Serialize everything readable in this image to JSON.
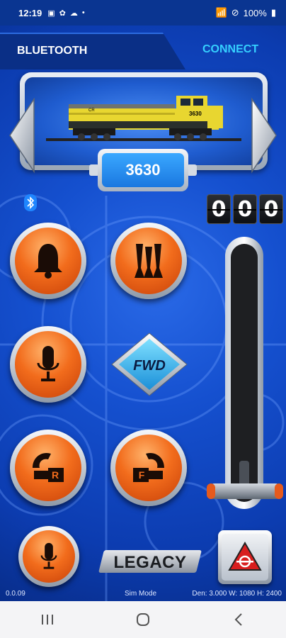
{
  "statusbar": {
    "time": "12:19",
    "battery": "100%"
  },
  "header": {
    "bluetooth_label": "BLUETOOTH",
    "connect_label": "CONNECT"
  },
  "engine": {
    "road_number": "3630",
    "cab_number": "3630",
    "brand_mark": "CR"
  },
  "counter": {
    "digits": [
      "0",
      "0",
      "0"
    ]
  },
  "controls": {
    "bell": "bell-icon",
    "horn": "horn-icon",
    "record": "microphone-icon",
    "direction_label": "FWD",
    "rear_coupler_label": "R",
    "front_coupler_label": "F",
    "voice": "microphone-icon"
  },
  "brand": {
    "legacy_label": "LEGACY"
  },
  "footer": {
    "version": "0.0.09",
    "mode": "Sim Mode",
    "dims": "Den: 3.000 W: 1080 H: 2400"
  },
  "colors": {
    "accent_cyan": "#35d0ff",
    "button_orange": "#f26c1c",
    "background_blue": "#0c3cb0"
  }
}
